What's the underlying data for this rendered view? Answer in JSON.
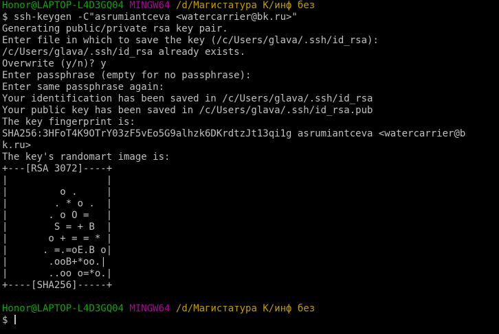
{
  "terminal": {
    "prompt1": {
      "user_host": "Honor@LAPTOP-L4D3GQ04",
      "system": "MINGW64",
      "path": "/d/Магистатура К/инф без"
    },
    "command": "$ ssh-keygen -C\"asrumiantceva <watercarrier@bk.ru>\"",
    "output_lines": [
      "Generating public/private rsa key pair.",
      "Enter file in which to save the key (/c/Users/glava/.ssh/id_rsa):",
      "/c/Users/glava/.ssh/id_rsa already exists.",
      "Overwrite (y/n)? y",
      "Enter passphrase (empty for no passphrase):",
      "Enter same passphrase again:",
      "Your identification has been saved in /c/Users/glava/.ssh/id_rsa",
      "Your public key has been saved in /c/Users/glava/.ssh/id_rsa.pub",
      "The key fingerprint is:",
      "SHA256:3HFoT4K9OTrY03zF5vEo5G9alhzk6DKrdtzJt13qi1g asrumiantceva <watercarrier@b",
      "k.ru>",
      "The key's randomart image is:",
      "+---[RSA 3072]----+",
      "|                 |",
      "|         o .     |",
      "|        . * o .  |",
      "|       . o O =   |",
      "|        S = + B  |",
      "|       o + = = * |",
      "|      . =.=oE.B o|",
      "|       .ooB+*oo.|",
      "|       ..oo o=*o.|",
      "+----[SHA256]-----+",
      ""
    ],
    "prompt2": {
      "user_host": "Honor@LAPTOP-L4D3GQ04",
      "system": "MINGW64",
      "path": "/d/Магистатура К/инф без"
    },
    "input_prompt": "$ "
  },
  "colors": {
    "background": "#000000",
    "text": "#c0c0c0",
    "user_host": "#13a10e",
    "system": "#b4009e",
    "path": "#c19c00"
  }
}
